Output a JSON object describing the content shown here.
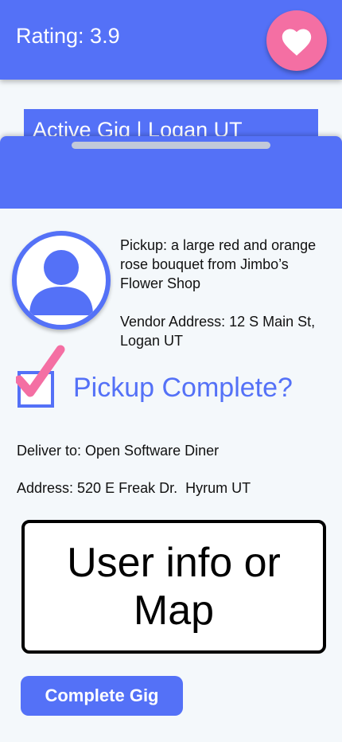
{
  "header": {
    "rating": "Rating: 3.9",
    "favorite_icon": "heart-icon",
    "favorite_color": "#f46fa3"
  },
  "gig": {
    "title": "Active Gig | Logan UT"
  },
  "details": {
    "pickup": "Pickup: a large red and orange rose bouquet from Jimbo’s Flower Shop",
    "vendor_address": "Vendor Address: 12 S Main St, Logan UT",
    "pickup_complete_label": "Pickup Complete?",
    "pickup_complete_checked": true,
    "deliver_to": "Deliver to: Open Software Diner",
    "address": "Address: 520 E Freak Dr.  Hyrum UT",
    "map_placeholder": "User info or Map",
    "complete_button": "Complete Gig"
  },
  "colors": {
    "primary": "#5471f7",
    "accent": "#f46fa3",
    "background": "#f4f8fb"
  }
}
